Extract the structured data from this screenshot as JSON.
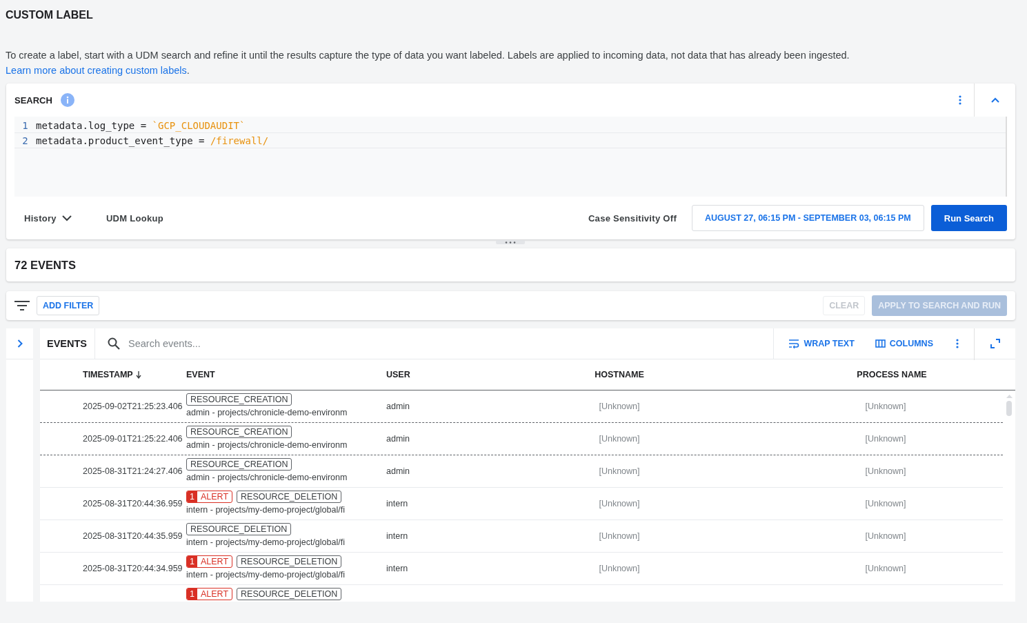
{
  "page": {
    "title": "CUSTOM LABEL",
    "intro": "To create a label, start with a UDM search and refine it until the results capture the type of data you want labeled. Labels are applied to incoming data, not data that has already been ingested.",
    "intro_link": "Learn more about creating custom labels",
    "intro_end": "."
  },
  "search": {
    "title": "SEARCH",
    "lines": [
      {
        "number": "1",
        "tokens": [
          {
            "text": "metadata.log_type = ",
            "kind": "plain"
          },
          {
            "text": "`GCP_CLOUDAUDIT`",
            "kind": "string"
          }
        ]
      },
      {
        "number": "2",
        "tokens": [
          {
            "text": "metadata.product_event_type = ",
            "kind": "plain"
          },
          {
            "text": "/firewall/",
            "kind": "string"
          }
        ]
      }
    ],
    "history": "History",
    "udm_lookup": "UDM Lookup",
    "case_sensitivity": "Case Sensitivity Off",
    "date_range": "AUGUST 27, 06:15 PM - SEPTEMBER 03, 06:15 PM",
    "run": "Run Search"
  },
  "results": {
    "count": "72 EVENTS"
  },
  "filters": {
    "add": "ADD FILTER",
    "clear": "CLEAR",
    "clear_disabled": true,
    "apply": "APPLY TO SEARCH AND RUN",
    "apply_disabled": true
  },
  "events": {
    "title": "EVENTS",
    "search_placeholder": "Search events...",
    "wrap": "WRAP TEXT",
    "columns_button": "COLUMNS",
    "columns": [
      {
        "label": "TIMESTAMP",
        "sorted": true
      },
      {
        "label": "EVENT",
        "sorted": false
      },
      {
        "label": "USER",
        "sorted": false
      },
      {
        "label": "HOSTNAME",
        "sorted": false
      },
      {
        "label": "PROCESS NAME",
        "sorted": false
      }
    ],
    "rows": [
      {
        "timestamp": "2025-09-02T21:25:23.406",
        "alert": null,
        "tag": "RESOURCE_CREATION",
        "description": "admin - projects/chronicle-demo-environm",
        "user": "admin",
        "hostname": "[Unknown]",
        "process": "[Unknown]",
        "dashed": true
      },
      {
        "timestamp": "2025-09-01T21:25:22.406",
        "alert": null,
        "tag": "RESOURCE_CREATION",
        "description": "admin - projects/chronicle-demo-environm",
        "user": "admin",
        "hostname": "[Unknown]",
        "process": "[Unknown]",
        "dashed": true
      },
      {
        "timestamp": "2025-08-31T21:24:27.406",
        "alert": null,
        "tag": "RESOURCE_CREATION",
        "description": "admin - projects/chronicle-demo-environm",
        "user": "admin",
        "hostname": "[Unknown]",
        "process": "[Unknown]",
        "dashed": false
      },
      {
        "timestamp": "2025-08-31T20:44:36.959",
        "alert": {
          "count": "1",
          "label": "ALERT"
        },
        "tag": "RESOURCE_DELETION",
        "description": "intern - projects/my-demo-project/global/fi",
        "user": "intern",
        "hostname": "[Unknown]",
        "process": "[Unknown]",
        "dashed": false
      },
      {
        "timestamp": "2025-08-31T20:44:35.959",
        "alert": null,
        "tag": "RESOURCE_DELETION",
        "description": "intern - projects/my-demo-project/global/fi",
        "user": "intern",
        "hostname": "[Unknown]",
        "process": "[Unknown]",
        "dashed": false
      },
      {
        "timestamp": "2025-08-31T20:44:34.959",
        "alert": {
          "count": "1",
          "label": "ALERT"
        },
        "tag": "RESOURCE_DELETION",
        "description": "intern - projects/my-demo-project/global/fi",
        "user": "intern",
        "hostname": "[Unknown]",
        "process": "[Unknown]",
        "dashed": false
      },
      {
        "alert": {
          "count": "1",
          "label": "ALERT"
        },
        "tag": "RESOURCE_DELETION"
      }
    ]
  }
}
